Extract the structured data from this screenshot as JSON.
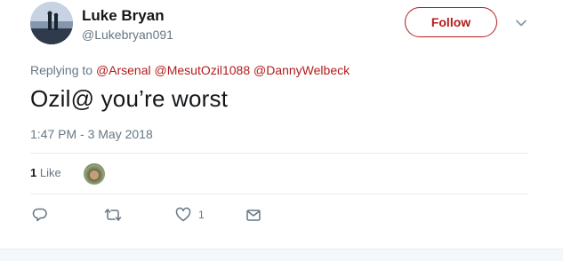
{
  "author": {
    "display_name": "Luke Bryan",
    "handle": "@Lukebryan091",
    "follow_label": "Follow"
  },
  "reply_context": {
    "prefix": "Replying to",
    "mentions": [
      "@Arsenal",
      "@MesutOzil1088",
      "@DannyWelbeck"
    ]
  },
  "tweet": {
    "text": "Ozil@ you’re worst",
    "timestamp": "1:47 PM - 3 May 2018"
  },
  "stats": {
    "like_count": "1",
    "like_label": "Like"
  },
  "actions": {
    "reply_icon": "reply-icon",
    "retweet_icon": "retweet-icon",
    "like_icon": "heart-icon",
    "like_count": "1",
    "dm_icon": "envelope-icon"
  },
  "colors": {
    "accent": "#b31b1b",
    "secondary_text": "#657786",
    "primary_text": "#14171a",
    "divider": "#e6ecf0"
  }
}
